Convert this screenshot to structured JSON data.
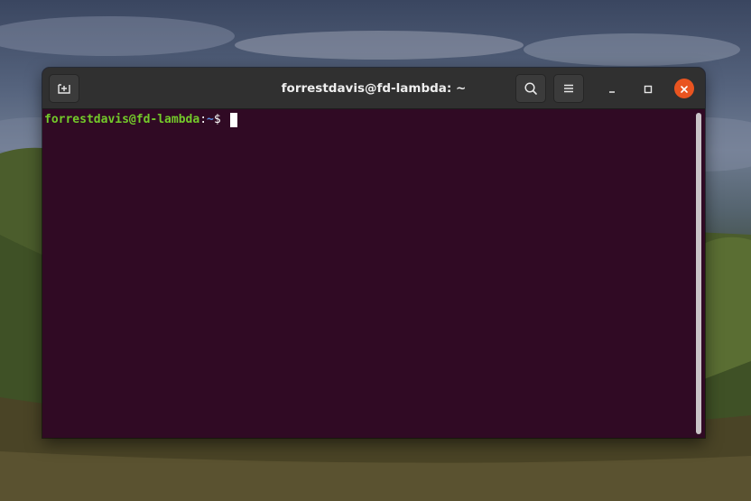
{
  "window": {
    "title": "forrestdavis@fd-lambda: ~"
  },
  "toolbar": {
    "new_tab_icon": "new-tab-icon",
    "search_icon": "search-icon",
    "menu_icon": "hamburger-menu-icon",
    "minimize_icon": "minimize-icon",
    "maximize_icon": "maximize-icon",
    "close_icon": "close-icon"
  },
  "terminal": {
    "prompt_user": "forrestdavis@fd-lambda",
    "prompt_colon": ":",
    "prompt_path": "~",
    "prompt_symbol": "$ ",
    "colors": {
      "background": "#300a24",
      "user": "#73c92a",
      "path": "#5d8ee0",
      "close_button": "#e95420"
    }
  }
}
